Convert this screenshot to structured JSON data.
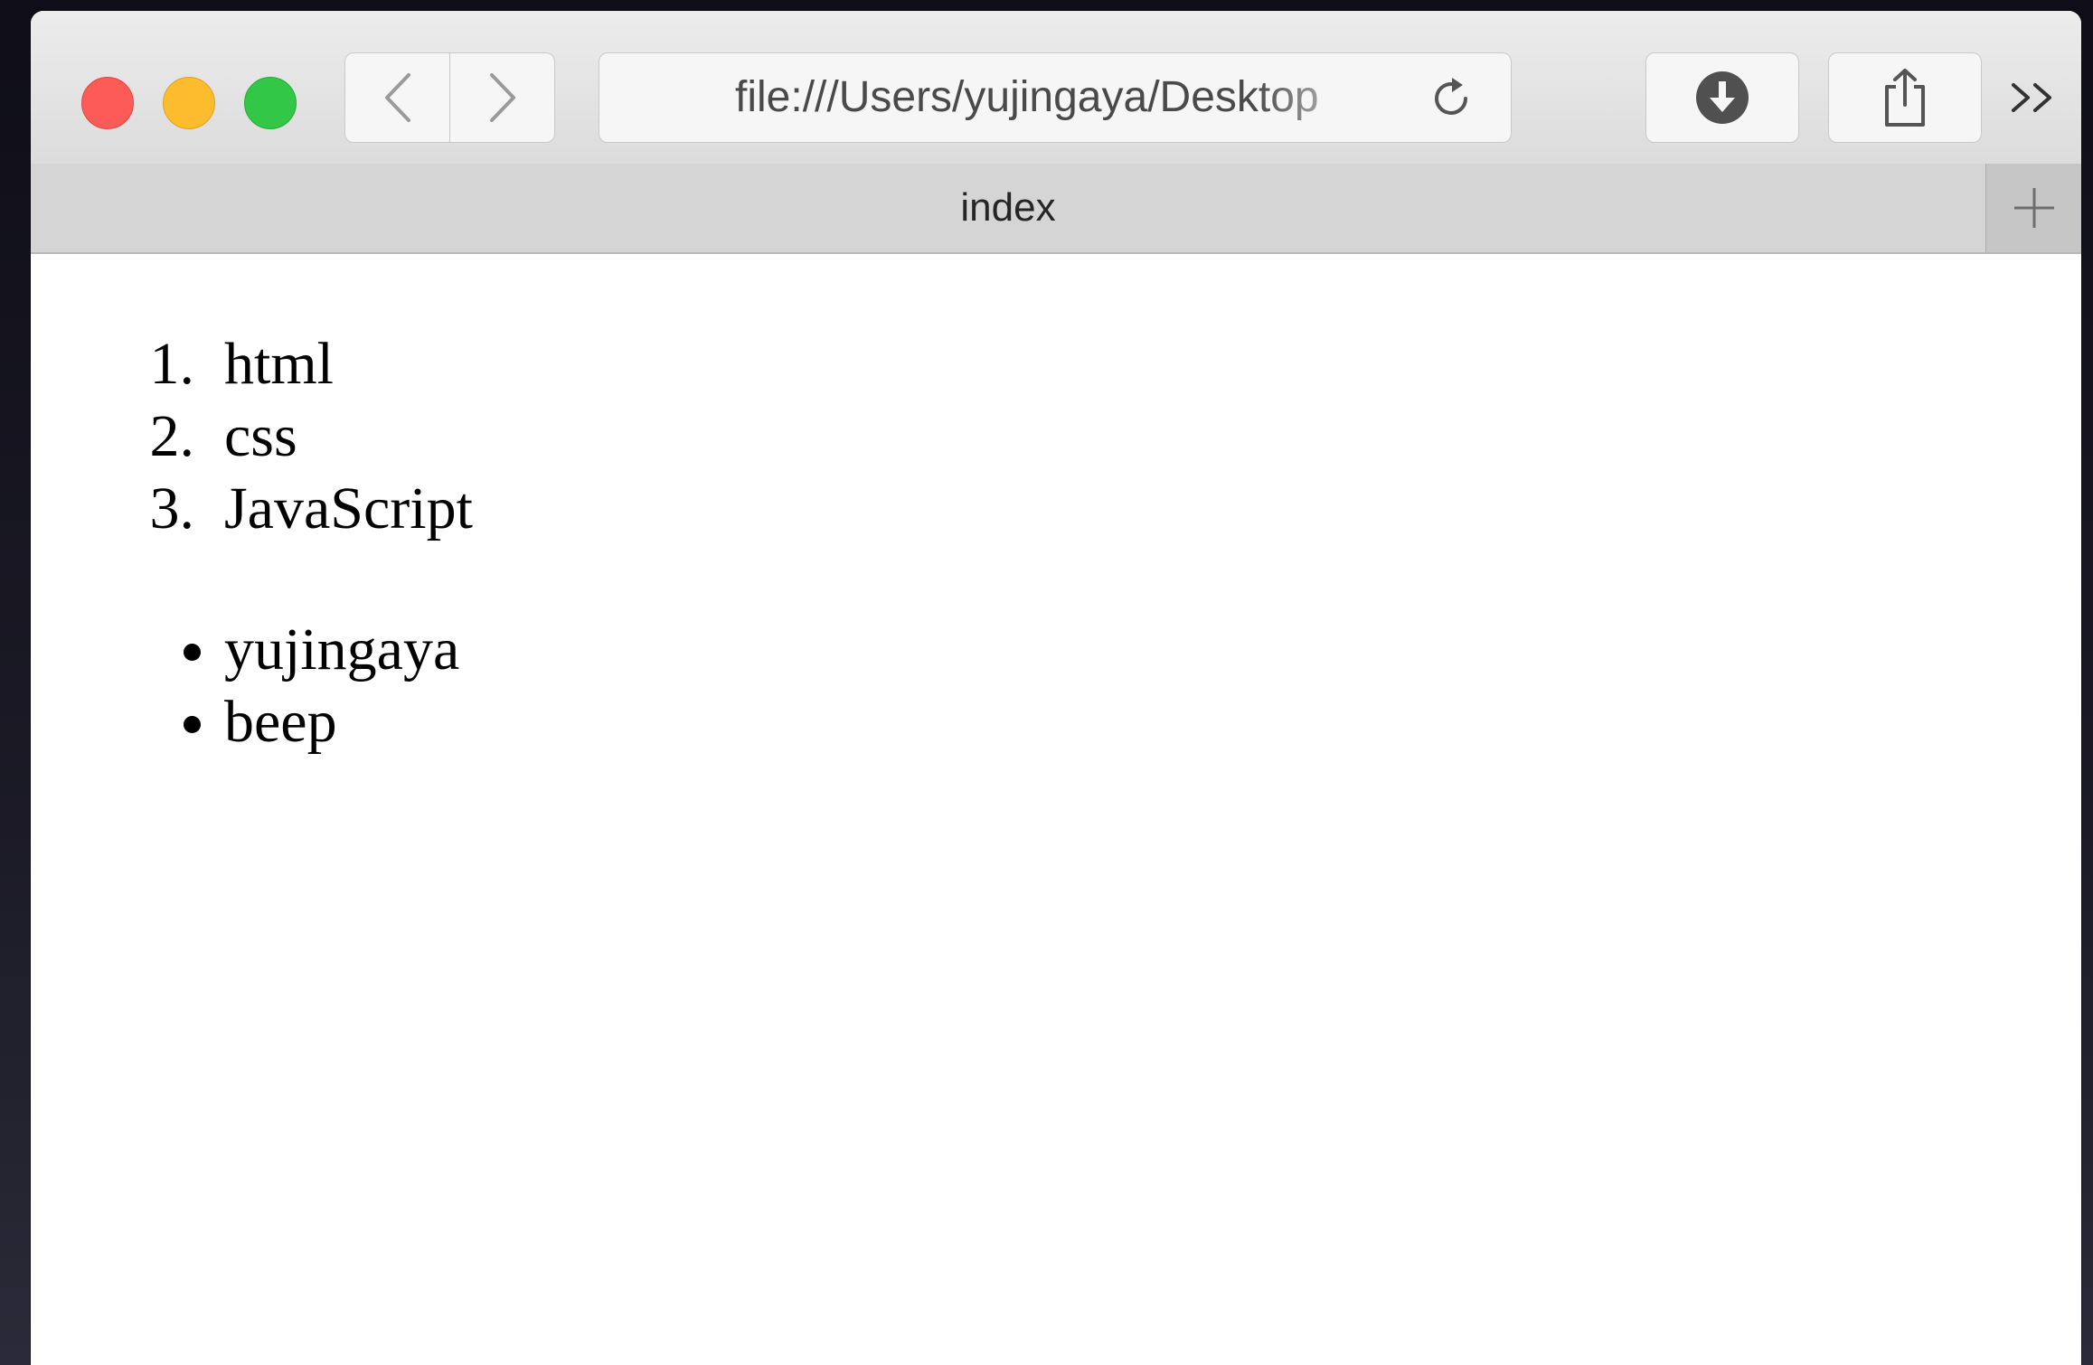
{
  "browser": {
    "address_url": "file:///Users/yujingaya/Desktop",
    "tab_title": "index"
  },
  "page": {
    "ordered_list": [
      "html",
      "css",
      "JavaScript"
    ],
    "unordered_list": [
      "yujingaya",
      "beep"
    ]
  },
  "icons": {
    "back": "chevron-left-icon",
    "forward": "chevron-right-icon",
    "reload": "reload-icon",
    "download": "download-icon",
    "share": "share-icon",
    "overflow": "double-chevron-right-icon",
    "new_tab": "plus-icon"
  },
  "colors": {
    "close": "#fc5b57",
    "minimize": "#fdbc2e",
    "maximize": "#33c748"
  }
}
